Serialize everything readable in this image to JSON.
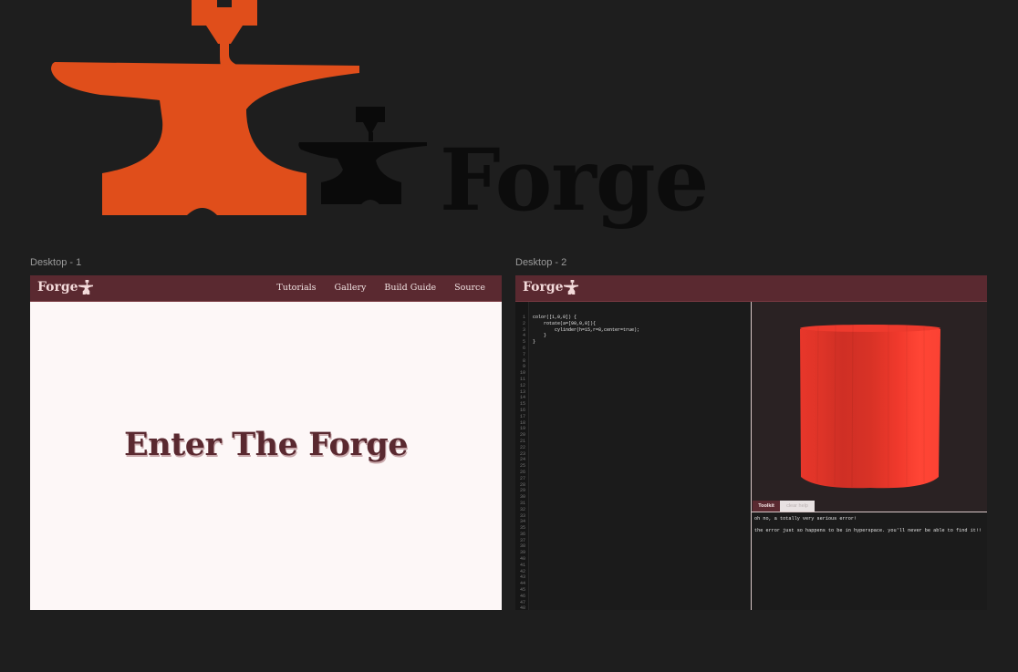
{
  "hero": {
    "wordmark": "Forge"
  },
  "frames": [
    {
      "label": "Desktop - 1",
      "brand": "Forge",
      "nav": [
        "Tutorials",
        "Gallery",
        "Build Guide",
        "Source"
      ],
      "headline": "Enter The Forge"
    },
    {
      "label": "Desktop - 2",
      "brand": "Forge",
      "code": "color([1,0,0]) {\n    rotate(a=[90,0,0]){\n        cylinder(h=15,r=8,center=true);\n    }\n}",
      "line_count": 48,
      "tabs": [
        "Toolkit",
        "clear help"
      ],
      "console": [
        "oh no, a totally very serious error!",
        "the error just so happens to be in hyperspace. you'll never be able to find it!!"
      ]
    }
  ],
  "colors": {
    "accent_orange": "#e04e1b",
    "navbar": "#5a2930",
    "cylinder": "#f23a2c",
    "canvas": "#1e1e1e"
  },
  "icons": [
    "anvil-printer-logo",
    "anvil-icon"
  ]
}
